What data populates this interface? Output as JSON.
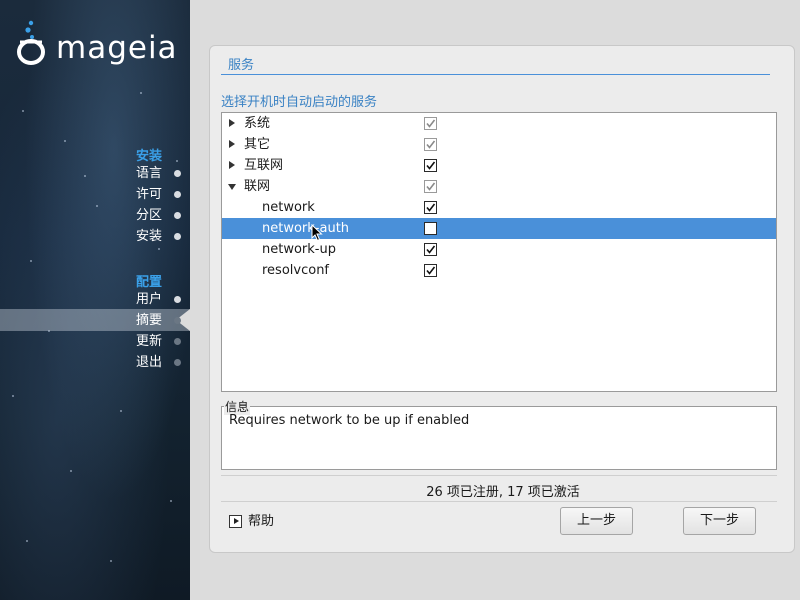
{
  "brand": {
    "logo_text": "mageia"
  },
  "sidebar": {
    "sections": [
      {
        "label": "安装",
        "items": [
          "语言",
          "许可",
          "分区",
          "安装"
        ]
      },
      {
        "label": "配置",
        "items": [
          "用户",
          "摘要",
          "更新",
          "退出"
        ]
      }
    ],
    "active_item": "摘要"
  },
  "panel": {
    "title": "服务",
    "subtitle": "选择开机时自动启动的服务"
  },
  "tree": {
    "rows": [
      {
        "label": "系统",
        "level": 0,
        "expander": "collapsed",
        "checked": true,
        "dim": true
      },
      {
        "label": "其它",
        "level": 0,
        "expander": "collapsed",
        "checked": true,
        "dim": true
      },
      {
        "label": "互联网",
        "level": 0,
        "expander": "collapsed",
        "checked": true,
        "dim": false
      },
      {
        "label": "联网",
        "level": 0,
        "expander": "expanded",
        "checked": true,
        "dim": true
      },
      {
        "label": "network",
        "level": 1,
        "checked": true,
        "dim": false
      },
      {
        "label": "network-auth",
        "level": 1,
        "checked": false,
        "dim": false,
        "selected": true
      },
      {
        "label": "network-up",
        "level": 1,
        "checked": true,
        "dim": false
      },
      {
        "label": "resolvconf",
        "level": 1,
        "checked": true,
        "dim": false
      }
    ]
  },
  "info": {
    "legend": "信息",
    "text": "Requires network to be up if enabled"
  },
  "status": "26 项已注册, 17 项已激活",
  "footer": {
    "help_label": "帮助",
    "previous_label": "上一步",
    "next_label": "下一步"
  },
  "colors": {
    "accent": "#4a90d9",
    "heading": "#3a82c4",
    "sidebar_section": "#3aa0e8"
  }
}
